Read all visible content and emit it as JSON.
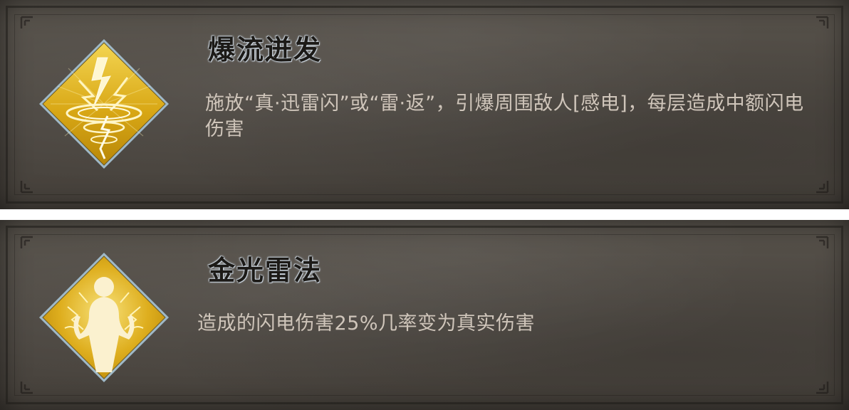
{
  "skills": [
    {
      "title": "爆流迸发",
      "description": "施放“真·迅雷闪”或“雷·返”，引爆周围敌人[感电]，每层造成中额闪电伤害",
      "icon": "lightning-vortex-icon"
    },
    {
      "title": "金光雷法",
      "description": "造成的闪电伤害25%几率变为真实伤害",
      "icon": "golden-light-figure-icon"
    }
  ],
  "colors": {
    "card_background": "#4f4a44",
    "title_text": "#1c1a17",
    "title_glow": "#d8e3ee",
    "description_text": "#cfc5ba",
    "icon_gold": "#d9a816",
    "icon_gold_light": "#f6df6a",
    "icon_border": "#9fb9c8"
  }
}
